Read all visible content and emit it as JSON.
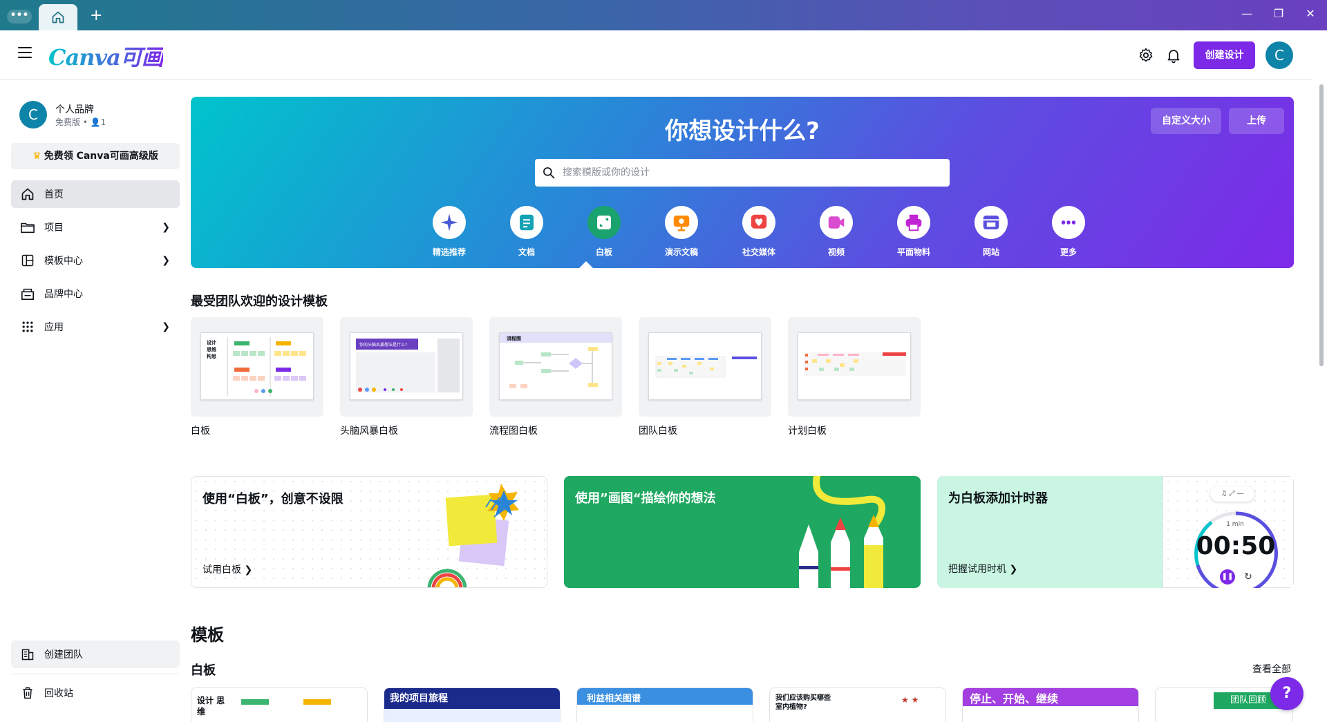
{
  "titlebar": {
    "menu_glyph": "•••",
    "plus_glyph": "+",
    "controls": [
      "—",
      "❐",
      "✕"
    ]
  },
  "header": {
    "logo_text": "Canva可画",
    "create_button": "创建设计",
    "avatar_initial": "C"
  },
  "sidebar": {
    "team_initial": "C",
    "team_name": "个人品牌",
    "team_meta": "免费版 • 👤1",
    "upgrade_button": "免费领 Canva可画高级版",
    "items": [
      {
        "label": "首页",
        "icon": "home-icon"
      },
      {
        "label": "项目",
        "icon": "folder-icon"
      },
      {
        "label": "模板中心",
        "icon": "template-icon"
      },
      {
        "label": "品牌中心",
        "icon": "brand-icon"
      },
      {
        "label": "应用",
        "icon": "apps-icon"
      }
    ],
    "bottom_items": [
      {
        "label": "创建团队",
        "icon": "team-icon"
      },
      {
        "label": "回收站",
        "icon": "trash-icon"
      }
    ]
  },
  "hero": {
    "title": "你想设计什么?",
    "custom_size_button": "自定义大小",
    "upload_button": "上传",
    "search_placeholder": "搜索模版或你的设计",
    "categories": [
      {
        "label": "精选推荐",
        "color": "#4a5bd4"
      },
      {
        "label": "文档",
        "color": "#13a3b5"
      },
      {
        "label": "白板",
        "color": "#1aa36f"
      },
      {
        "label": "演示文稿",
        "color": "#ff8a00"
      },
      {
        "label": "社交媒体",
        "color": "#ef4444"
      },
      {
        "label": "视频",
        "color": "#d94ccf"
      },
      {
        "label": "平面物料",
        "color": "#c026d3"
      },
      {
        "label": "网站",
        "color": "#5b4fe0"
      },
      {
        "label": "更多",
        "color": "#7d2ae8"
      }
    ],
    "active_category": "白板"
  },
  "popular": {
    "heading": "最受团队欢迎的设计模板",
    "items": [
      {
        "label": "白板",
        "preview_text": "设计 思维 构思"
      },
      {
        "label": "头脑风暴白板",
        "preview_text": "你的头脑风暴想法是什么?"
      },
      {
        "label": "流程图白板",
        "preview_text": "流程图"
      },
      {
        "label": "团队白板",
        "preview_text": ""
      },
      {
        "label": "计划白板",
        "preview_text": ""
      }
    ]
  },
  "promos": [
    {
      "title": "使用“白板”，创意不设限",
      "link": "试用白板"
    },
    {
      "title": "使用”画图“描绘你的想法",
      "link": ""
    },
    {
      "title": "为白板添加计时器",
      "link": "把握试用时机",
      "timer": "00:50",
      "timer_label": "1 min"
    }
  ],
  "templates": {
    "heading": "模板",
    "subheading": "白板",
    "see_all": "查看全部",
    "items": [
      {
        "title": "设计 思维",
        "color": "#ffffff",
        "text_color": "#0e1318"
      },
      {
        "title": "我的项目旅程",
        "color": "#1a2b8c",
        "text_color": "#ffffff"
      },
      {
        "title": "利益相关图谱",
        "color": "#3b8fe0",
        "text_color": "#ffffff"
      },
      {
        "title": "我们应该购买哪些室内植物?",
        "color": "#ffffff",
        "text_color": "#0e1318"
      },
      {
        "title": "停止、开始、继续",
        "color": "#a33fe0",
        "text_color": "#ffffff"
      },
      {
        "title": "团队回顾",
        "color": "#ffffff",
        "text_color": "#ffffff"
      }
    ]
  },
  "help_button": "?"
}
